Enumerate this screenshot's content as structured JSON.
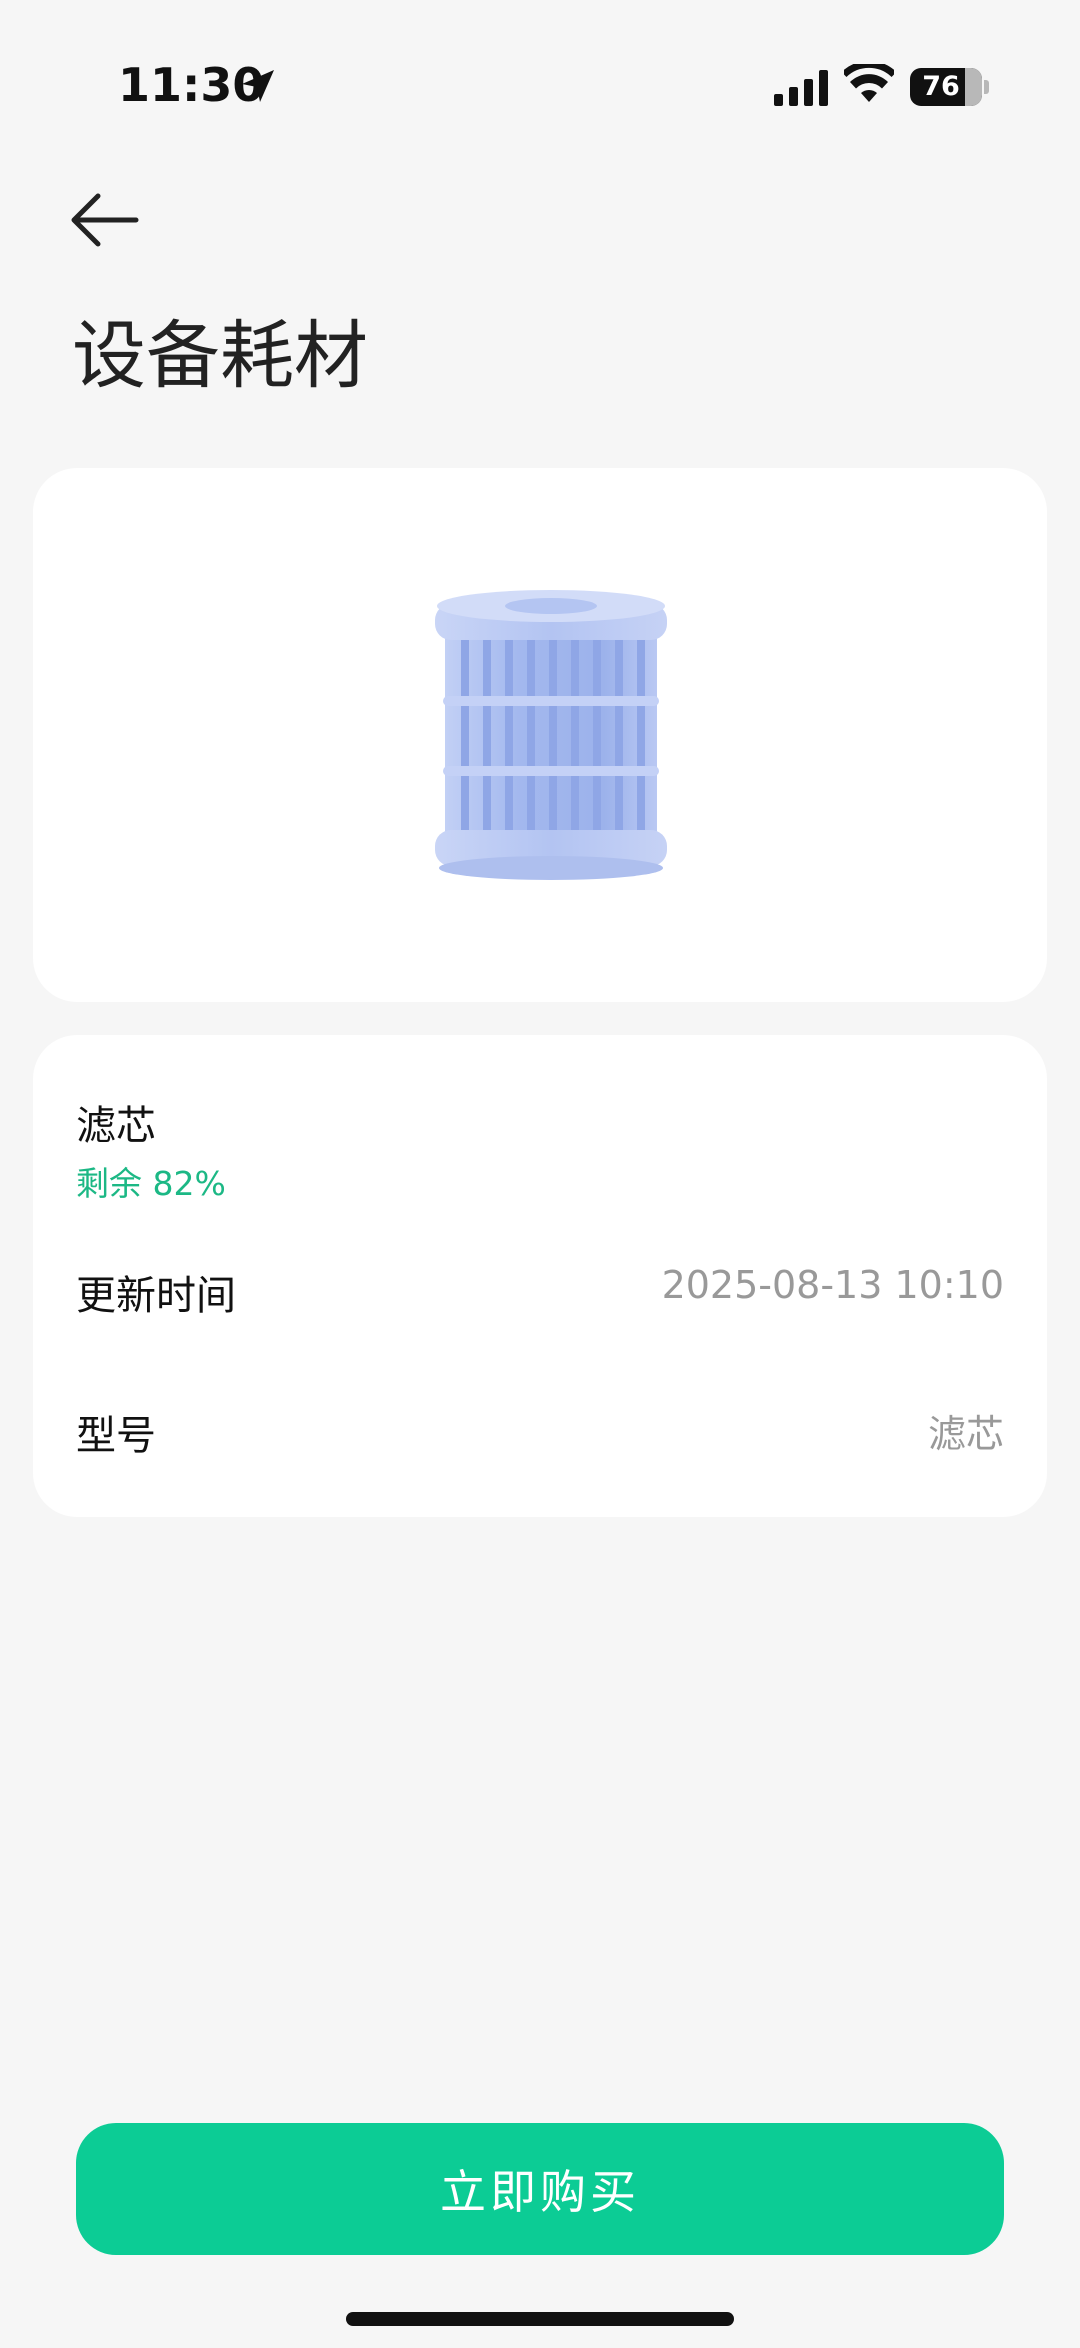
{
  "status_bar": {
    "time": "11:30",
    "battery_level": 76,
    "battery_text": "76"
  },
  "header": {
    "back_icon": "arrow-left-icon",
    "title": "设备耗材"
  },
  "product": {
    "image_icon": "filter-cartridge-image"
  },
  "consumable": {
    "name": "滤芯",
    "remaining_text": "剩余 82%",
    "remaining_percent": 82
  },
  "details": [
    {
      "label": "更新时间",
      "value": "2025-08-13 10:10"
    },
    {
      "label": "型号",
      "value": "滤芯"
    }
  ],
  "actions": {
    "buy_label": "立即购买"
  },
  "colors": {
    "accent": "#0ccc95",
    "remaining_text": "#1cb885",
    "background": "#f6f6f6",
    "filter_blue": "#a9bdf0"
  }
}
